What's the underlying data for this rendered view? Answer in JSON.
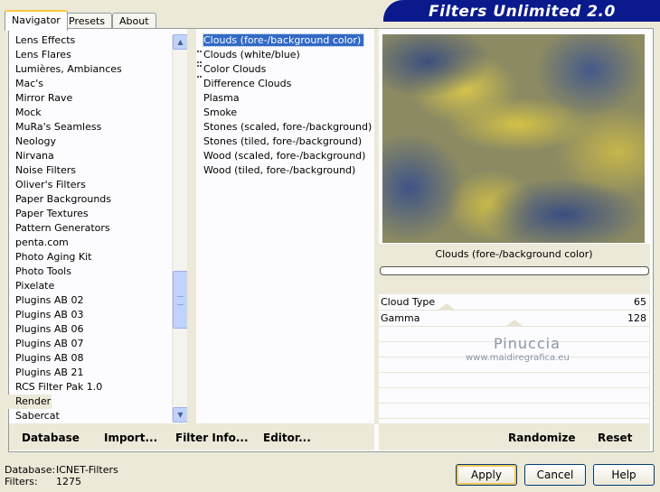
{
  "tabs": [
    "Navigator",
    "Presets",
    "About"
  ],
  "banner": {
    "title": "Filters Unlimited 2.0"
  },
  "categories": [
    "Lens Effects",
    "Lens Flares",
    "Lumières, Ambiances",
    "Mac's",
    "Mirror Rave",
    "Mock",
    "MuRa's Seamless",
    "Neology",
    "Nirvana",
    "Noise Filters",
    "Oliver's Filters",
    "Paper Backgrounds",
    "Paper Textures",
    "Pattern Generators",
    "penta.com",
    "Photo Aging Kit",
    "Photo Tools",
    "Pixelate",
    "Plugins AB 02",
    "Plugins AB 03",
    "Plugins AB 06",
    "Plugins AB 07",
    "Plugins AB 08",
    "Plugins AB 21",
    "RCS Filter Pak 1.0",
    "Render",
    "Sabercat"
  ],
  "selected_category": "Render",
  "filters": [
    "Clouds (fore-/background color)",
    "Clouds (white/blue)",
    "Color Clouds",
    "Difference Clouds",
    "Plasma",
    "Smoke",
    "Stones (scaled, fore-/background)",
    "Stones (tiled, fore-/background)",
    "Wood (scaled, fore-/background)",
    "Wood (tiled, fore-/background)"
  ],
  "selected_filter": "Clouds (fore-/background color)",
  "preview": {
    "filter_name": "Clouds (fore-/background color)"
  },
  "params": [
    {
      "name": "Cloud Type",
      "value": "65"
    },
    {
      "name": "Gamma",
      "value": "128"
    }
  ],
  "watermark": {
    "name": "Pinuccia",
    "url": "www.maidiregrafica.eu"
  },
  "toolbar": {
    "database": "Database",
    "import": "Import...",
    "filter_info": "Filter Info...",
    "editor": "Editor...",
    "randomize": "Randomize",
    "reset": "Reset"
  },
  "status": {
    "database_label": "Database:",
    "database_value": "ICNET-Filters",
    "filters_label": "Filters:",
    "filters_value": "1275"
  },
  "buttons": {
    "apply": "Apply",
    "cancel": "Cancel",
    "help": "Help"
  }
}
